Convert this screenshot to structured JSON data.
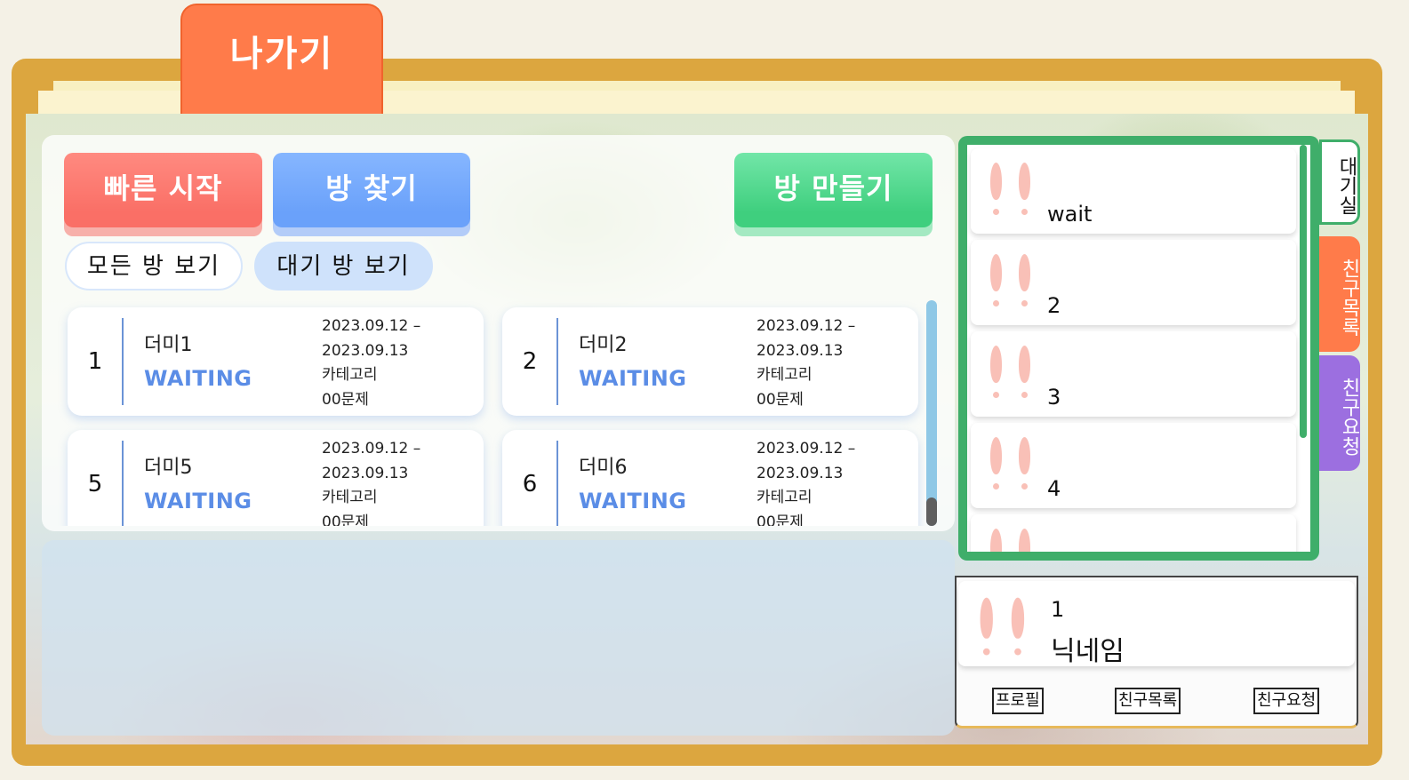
{
  "header": {
    "exit_label": "나가기"
  },
  "actions": {
    "quick_start": "빠른 시작",
    "find_room": "방 찾기",
    "create_room": "방 만들기"
  },
  "filters": {
    "all_rooms": "모든 방 보기",
    "waiting_rooms": "대기 방 보기"
  },
  "rooms": [
    {
      "number": "1",
      "name": "더미1",
      "status": "WAITING",
      "date_start": "2023.09.12 –",
      "date_end": "2023.09.13",
      "category": "카테고리",
      "problems": "00문제"
    },
    {
      "number": "2",
      "name": "더미2",
      "status": "WAITING",
      "date_start": "2023.09.12 –",
      "date_end": "2023.09.13",
      "category": "카테고리",
      "problems": "00문제"
    },
    {
      "number": "5",
      "name": "더미5",
      "status": "WAITING",
      "date_start": "2023.09.12 –",
      "date_end": "2023.09.13",
      "category": "카테고리",
      "problems": "00문제"
    },
    {
      "number": "6",
      "name": "더미6",
      "status": "WAITING",
      "date_start": "2023.09.12 –",
      "date_end": "2023.09.13",
      "category": "카테고리",
      "problems": "00문제"
    }
  ],
  "side_panel": {
    "users": [
      {
        "name": "wait"
      },
      {
        "name": "2"
      },
      {
        "name": "3"
      },
      {
        "name": "4"
      },
      {
        "name": ""
      }
    ],
    "tabs": {
      "waiting_room": "대기실",
      "friends_list": "친구목록",
      "friend_requests": "친구요청"
    }
  },
  "profile": {
    "number": "1",
    "nickname": "닉네임",
    "buttons": {
      "profile": "프로필",
      "friends_list": "친구목록",
      "friend_requests": "친구요청"
    }
  },
  "colors": {
    "frame": "#dca63f",
    "quick_start": "#fa6f66",
    "find_room": "#6aa1fa",
    "create_room": "#3fcf7e",
    "status": "#5b8de6",
    "side_border": "#3fae6a",
    "tab_friends": "#ff7b4a",
    "tab_requests": "#9c6fe0"
  },
  "icons": {
    "avatar": "bunny-ears-icon"
  }
}
